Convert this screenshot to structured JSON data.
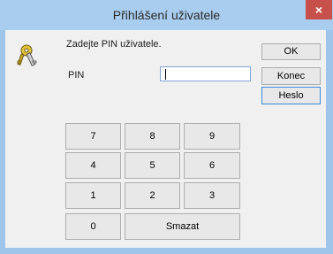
{
  "window": {
    "title": "Přihlášení uživatele",
    "close_label": "×"
  },
  "dialog": {
    "prompt": "Zadejte PIN uživatele.",
    "pin_label": "PIN",
    "pin_value": "",
    "icon": "keys-icon"
  },
  "buttons": {
    "ok": "OK",
    "exit": "Konec",
    "password": "Heslo"
  },
  "keypad": {
    "k7": "7",
    "k8": "8",
    "k9": "9",
    "k4": "4",
    "k5": "5",
    "k6": "6",
    "k1": "1",
    "k2": "2",
    "k3": "3",
    "k0": "0",
    "clear": "Smazat"
  }
}
